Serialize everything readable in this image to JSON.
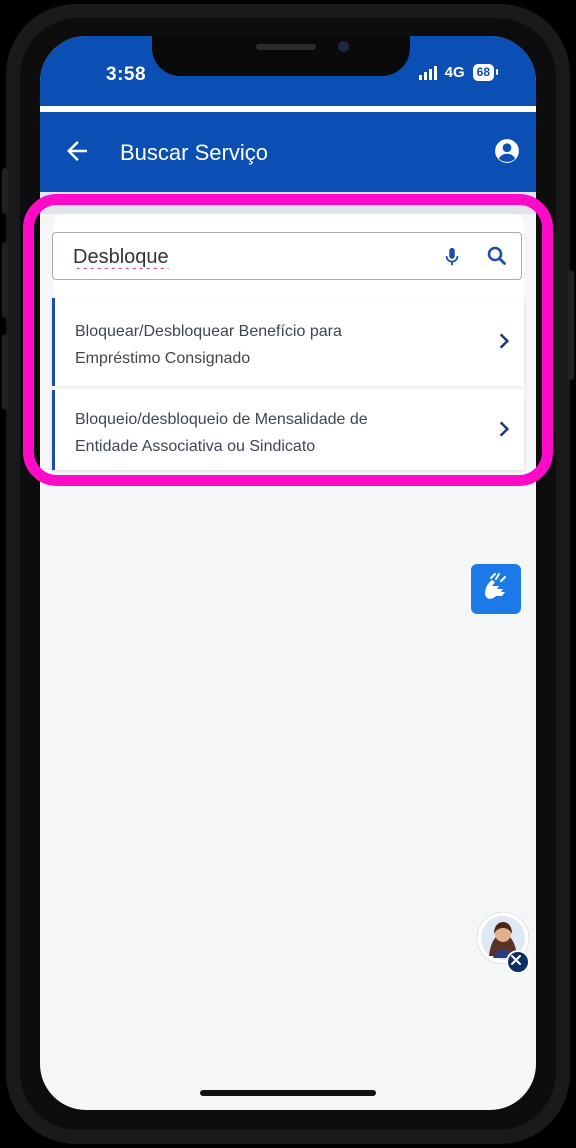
{
  "status_bar": {
    "time": "3:58",
    "network": "4G",
    "battery": "68"
  },
  "header": {
    "title": "Buscar Serviço",
    "back_icon": "arrow-left-icon",
    "account_icon": "user-circle-icon"
  },
  "search": {
    "value": "Desbloque",
    "mic_icon": "microphone-icon",
    "search_icon": "search-icon"
  },
  "results": [
    {
      "line1": "Bloquear/Desbloquear Benefício para",
      "line2": "Empréstimo Consignado"
    },
    {
      "line1": "Bloqueio/desbloqueio de Mensalidade de",
      "line2": "Entidade Associativa ou Sindicato"
    }
  ],
  "colors": {
    "primary": "#0b4fb4",
    "highlight": "#ff0ac8",
    "libras_button": "#1b7ae8",
    "result_accent": "#1e4fa8"
  },
  "floating": {
    "libras_icon": "sign-language-icon",
    "assistant_icon": "assistant-avatar-icon",
    "close_icon": "close-icon"
  }
}
